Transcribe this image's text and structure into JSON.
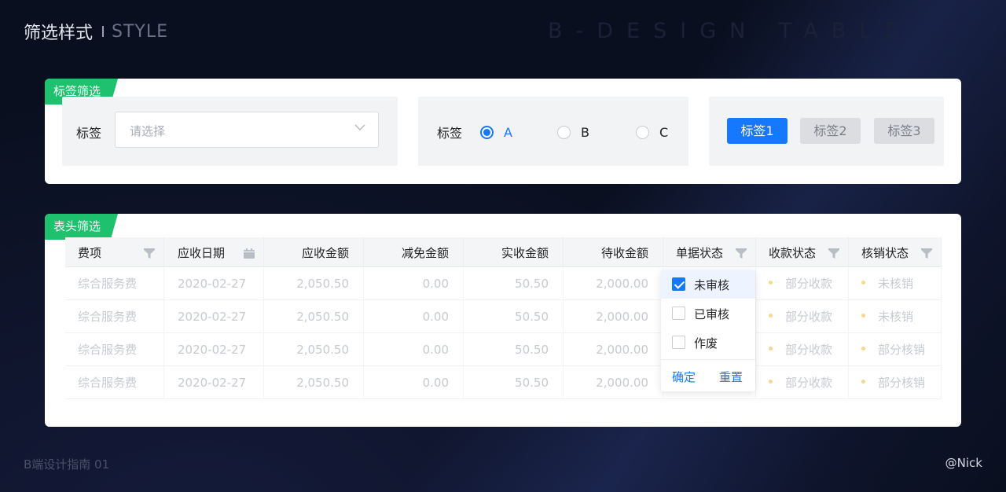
{
  "header": {
    "title_zh": "筛选样式",
    "title_en": "STYLE",
    "bg_word": "B-DESIGN TABLE"
  },
  "footer": {
    "left": "B端设计指南 01",
    "right": "@Nick"
  },
  "tag_filter": {
    "flag": "标签筛选",
    "select": {
      "label": "标签",
      "placeholder": "请选择"
    },
    "radio": {
      "label": "标签",
      "options": [
        "A",
        "B",
        "C"
      ],
      "selected": "A"
    },
    "chips": [
      {
        "label": "标签1",
        "active": true
      },
      {
        "label": "标签2",
        "active": false
      },
      {
        "label": "标签3",
        "active": false
      }
    ]
  },
  "header_filter": {
    "flag": "表头筛选",
    "columns": [
      "费项",
      "应收日期",
      "应收金额",
      "减免金额",
      "实收金额",
      "待收金额",
      "单据状态",
      "收款状态",
      "核销状态"
    ],
    "rows": [
      [
        "综合服务费",
        "2020-02-27",
        "2,050.50",
        "0.00",
        "50.50",
        "2,000.00",
        "",
        "部分收款",
        "未核销"
      ],
      [
        "综合服务费",
        "2020-02-27",
        "2,050.50",
        "0.00",
        "50.50",
        "2,000.00",
        "",
        "部分收款",
        "未核销"
      ],
      [
        "综合服务费",
        "2020-02-27",
        "2,050.50",
        "0.00",
        "50.50",
        "2,000.00",
        "",
        "部分收款",
        "部分核销"
      ],
      [
        "综合服务费",
        "2020-02-27",
        "2,050.50",
        "0.00",
        "50.50",
        "2,000.00",
        "",
        "部分收款",
        "部分核销"
      ]
    ],
    "dropdown": {
      "options": [
        {
          "label": "未审核",
          "checked": true
        },
        {
          "label": "已审核",
          "checked": false
        },
        {
          "label": "作废",
          "checked": false
        }
      ],
      "confirm": "确定",
      "reset": "重置"
    }
  },
  "colors": {
    "accent": "#1677ff",
    "flag": "#1ec26e",
    "status_dot": "#f6d88f"
  },
  "icons": {
    "filter": "funnel-icon",
    "date": "calendar-icon",
    "select": "chevron-down-icon"
  }
}
